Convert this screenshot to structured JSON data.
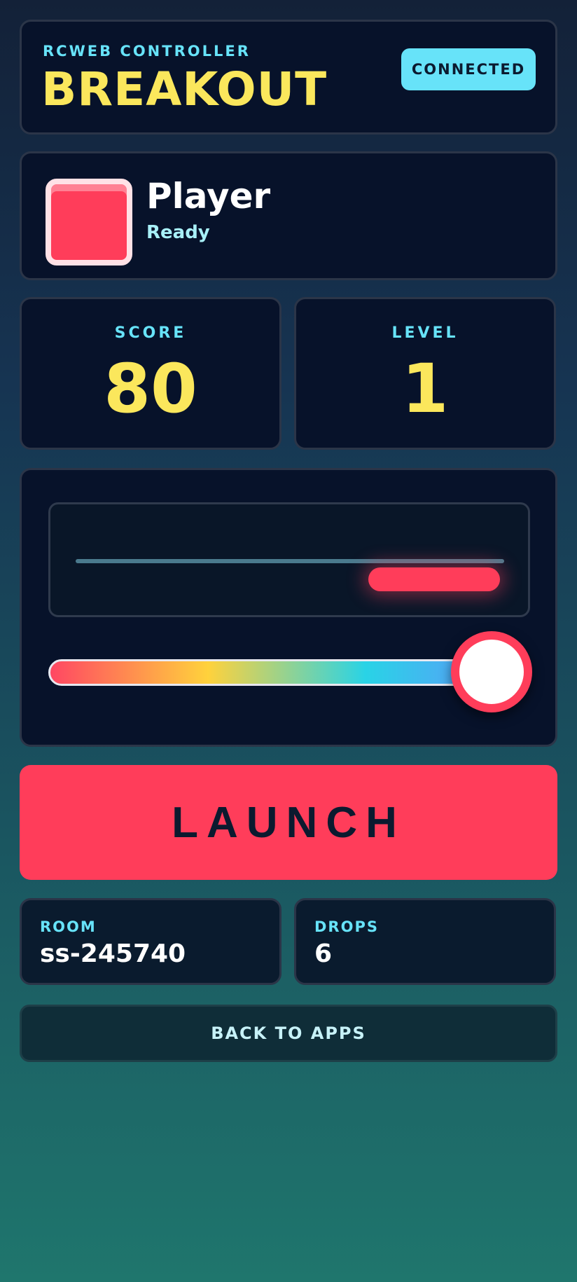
{
  "header": {
    "subtitle": "RCWEB CONTROLLER",
    "title": "BREAKOUT",
    "status_badge": "CONNECTED"
  },
  "player": {
    "name": "Player",
    "status": "Ready",
    "color": "#ff3d5a"
  },
  "stats": {
    "score_label": "SCORE",
    "score": "80",
    "level_label": "LEVEL",
    "level": "1"
  },
  "control": {
    "paddle_position": 0.92,
    "slider_value": 0.92
  },
  "launch_label": "LAUNCH",
  "info": {
    "room_label": "ROOM",
    "room": "ss-245740",
    "drops_label": "DROPS",
    "drops": "6"
  },
  "back_label": "BACK TO APPS",
  "colors": {
    "accent": "#67e3f9",
    "highlight": "#fbe75c",
    "brand": "#ff3d5a"
  }
}
